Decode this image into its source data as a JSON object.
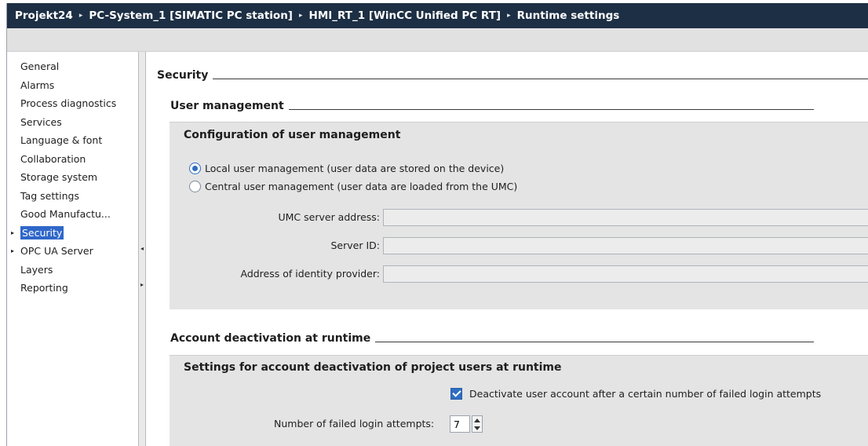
{
  "breadcrumb": {
    "items": [
      "Projekt24",
      "PC-System_1 [SIMATIC PC station]",
      "HMI_RT_1 [WinCC Unified PC RT]",
      "Runtime settings"
    ],
    "separator": "▸"
  },
  "nav": {
    "items": [
      {
        "label": "General",
        "expandable": false,
        "active": false
      },
      {
        "label": "Alarms",
        "expandable": false,
        "active": false
      },
      {
        "label": "Process diagnostics",
        "expandable": false,
        "active": false
      },
      {
        "label": "Services",
        "expandable": false,
        "active": false
      },
      {
        "label": "Language & font",
        "expandable": false,
        "active": false
      },
      {
        "label": "Collaboration",
        "expandable": false,
        "active": false
      },
      {
        "label": "Storage system",
        "expandable": false,
        "active": false
      },
      {
        "label": "Tag settings",
        "expandable": false,
        "active": false
      },
      {
        "label": "Good Manufactu...",
        "expandable": false,
        "active": false
      },
      {
        "label": "Security",
        "expandable": true,
        "active": true
      },
      {
        "label": "OPC UA Server",
        "expandable": true,
        "active": false
      },
      {
        "label": "Layers",
        "expandable": false,
        "active": false
      },
      {
        "label": "Reporting",
        "expandable": false,
        "active": false
      }
    ]
  },
  "splitter": {
    "collapse_icon": "◂",
    "expand_icon": "▸"
  },
  "security": {
    "title": "Security",
    "user_management": {
      "title": "User management",
      "group_title": "Configuration of user management",
      "options": [
        {
          "label": "Local user management (user data are stored on the device)",
          "selected": true
        },
        {
          "label": "Central user management (user data are loaded from the UMC)",
          "selected": false
        }
      ],
      "fields": [
        {
          "label": "UMC server address:",
          "value": ""
        },
        {
          "label": "Server ID:",
          "value": ""
        },
        {
          "label": "Address of identity provider:",
          "value": ""
        }
      ]
    },
    "account_deactivation": {
      "title": "Account deactivation at runtime",
      "group_title": "Settings for account deactivation of project users at runtime",
      "checkbox_label": "Deactivate user account after a certain number of failed login attempts",
      "checkbox_checked": true,
      "attempts_label": "Number of failed login attempts:",
      "attempts_value": "7"
    }
  },
  "colors": {
    "titlebar_bg": "#1d2f44",
    "accent": "#2e6dc2",
    "selected_nav": "#2f67c9",
    "group_bg": "#e4e4e4"
  }
}
